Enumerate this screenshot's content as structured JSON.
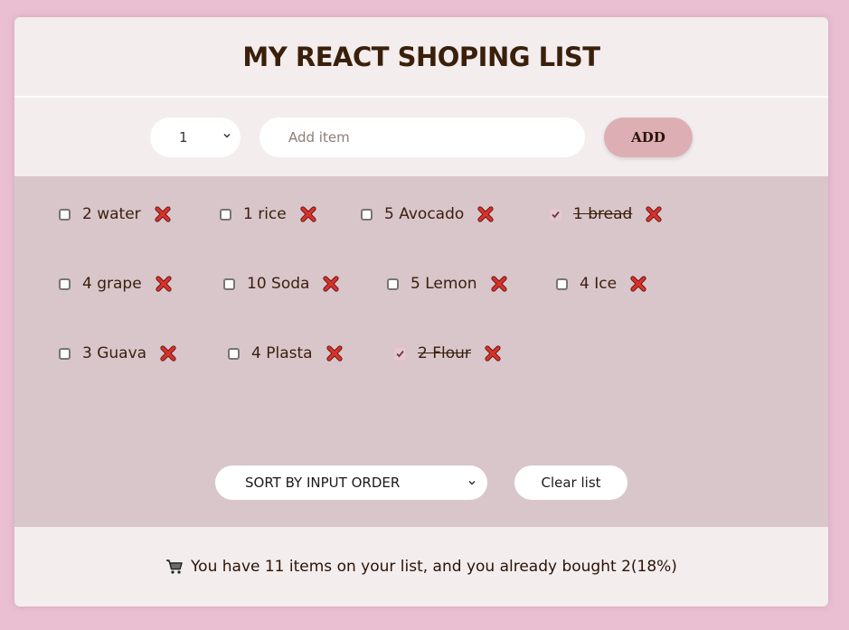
{
  "header": {
    "title": "MY REACT SHOPING LIST"
  },
  "form": {
    "quantity_value": "1",
    "item_placeholder": "Add item",
    "add_label": "ADD"
  },
  "items": [
    {
      "label": "2 water",
      "packed": false
    },
    {
      "label": "1 rice",
      "packed": false
    },
    {
      "label": "5 Avocado",
      "packed": false
    },
    {
      "label": "1 bread",
      "packed": true
    },
    {
      "label": "4 grape",
      "packed": false
    },
    {
      "label": "10 Soda",
      "packed": false
    },
    {
      "label": "5 Lemon",
      "packed": false
    },
    {
      "label": "4 Ice",
      "packed": false
    },
    {
      "label": "3 Guava",
      "packed": false
    },
    {
      "label": "4 Plasta",
      "packed": false
    },
    {
      "label": "2 Flour",
      "packed": true
    }
  ],
  "actions": {
    "sort_value": "SORT BY INPUT ORDER",
    "clear_label": "Clear list"
  },
  "stats": {
    "icon": "cart-icon",
    "text": "You have 11 items on your list, and you already bought 2(18%)"
  },
  "colors": {
    "page_bg": "#eabfd2",
    "panel_bg": "#f3eded",
    "list_bg": "#d9c6cb",
    "add_button_bg": "#ddafb5",
    "delete_icon": "#d9312b"
  }
}
